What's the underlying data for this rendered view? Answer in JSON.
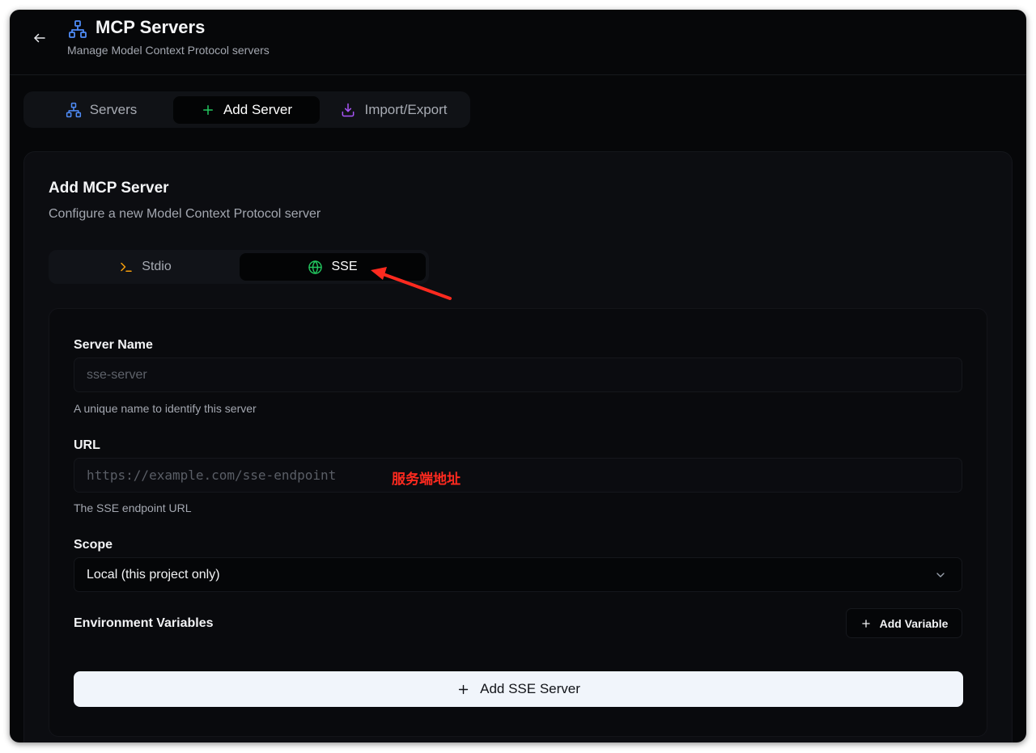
{
  "header": {
    "title": "MCP Servers",
    "subtitle": "Manage Model Context Protocol servers",
    "back_icon": "arrow-left-icon",
    "title_icon": "network-icon"
  },
  "tabs": [
    {
      "label": "Servers",
      "icon": "network-icon",
      "active": false
    },
    {
      "label": "Add Server",
      "icon": "plus-icon",
      "active": true
    },
    {
      "label": "Import/Export",
      "icon": "download-icon",
      "active": false
    }
  ],
  "card": {
    "title": "Add MCP Server",
    "description": "Configure a new Model Context Protocol server"
  },
  "transport": [
    {
      "label": "Stdio",
      "icon": "terminal-icon",
      "active": false
    },
    {
      "label": "SSE",
      "icon": "globe-icon",
      "active": true
    }
  ],
  "form": {
    "server_name": {
      "label": "Server Name",
      "placeholder": "sse-server",
      "hint": "A unique name to identify this server"
    },
    "url": {
      "label": "URL",
      "placeholder": "https://example.com/sse-endpoint",
      "hint": "The SSE endpoint URL"
    },
    "scope": {
      "label": "Scope",
      "value": "Local (this project only)"
    },
    "env": {
      "label": "Environment Variables",
      "add_button": "Add Variable"
    },
    "submit": "Add SSE Server"
  },
  "annotation": {
    "text": "服务端地址",
    "color": "#ff2a1f"
  },
  "colors": {
    "background": "#060709",
    "accent_blue": "#4f8cf7",
    "accent_green": "#22c55e",
    "accent_purple": "#a855f7",
    "accent_orange": "#f59e0b",
    "primary_button": "#f1f5fb"
  }
}
